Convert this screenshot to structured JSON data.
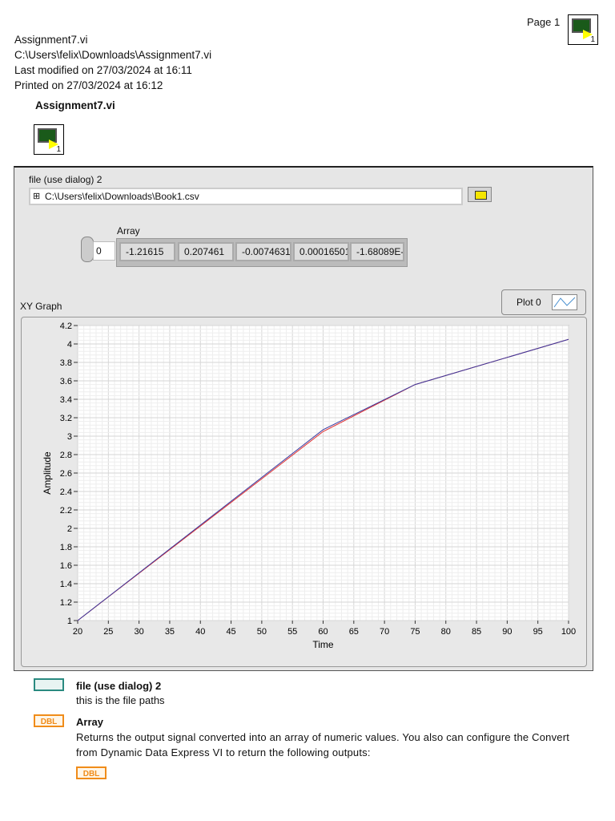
{
  "header": {
    "page": "Page 1",
    "lines": [
      "Assignment7.vi",
      "C:\\Users\\felix\\Downloads\\Assignment7.vi",
      "Last modified on 27/03/2024 at 16:11",
      "Printed on 27/03/2024 at 16:12"
    ],
    "vi_title": "Assignment7.vi",
    "icon_number": "1"
  },
  "panel": {
    "file_label": "file (use dialog) 2",
    "file_path": "C:\\Users\\felix\\Downloads\\Book1.csv",
    "array_label": "Array",
    "array_index": "0",
    "array_values": [
      "-1.21615",
      "0.207461",
      "-0.0074631:",
      "0.00016501'",
      "-1.68089E-("
    ],
    "graph_label": "XY Graph",
    "legend_label": "Plot 0"
  },
  "chart_data": {
    "type": "line",
    "xlabel": "Time",
    "ylabel": "Amplitude",
    "xlim": [
      20,
      100
    ],
    "ylim": [
      1,
      4.2
    ],
    "grid": true,
    "xticks": [
      "20",
      "25",
      "30",
      "35",
      "40",
      "45",
      "50",
      "55",
      "60",
      "65",
      "70",
      "75",
      "80",
      "85",
      "90",
      "95",
      "100"
    ],
    "yticks": [
      "1",
      "1.2",
      "1.4",
      "1.6",
      "1.8",
      "2",
      "2.2",
      "2.4",
      "2.6",
      "2.8",
      "3",
      "3.2",
      "3.4",
      "3.6",
      "3.8",
      "4",
      "4.2"
    ],
    "series": [
      {
        "name": "red",
        "color": "#e03030",
        "x": [
          20,
          60,
          75,
          100
        ],
        "y": [
          1.0,
          3.05,
          3.56,
          4.05
        ]
      },
      {
        "name": "Plot 0",
        "color": "#3a3aa0",
        "x": [
          20,
          60,
          75,
          100
        ],
        "y": [
          1.0,
          3.07,
          3.56,
          4.05
        ]
      }
    ]
  },
  "descriptions": [
    {
      "title": "file (use dialog) 2",
      "text": "this is the file paths"
    },
    {
      "title": "Array",
      "text": "Returns the output signal converted into an array of numeric values. You also can configure the Convert from Dynamic Data Express VI to return the following outputs:"
    }
  ],
  "dbl_label": "DBL"
}
